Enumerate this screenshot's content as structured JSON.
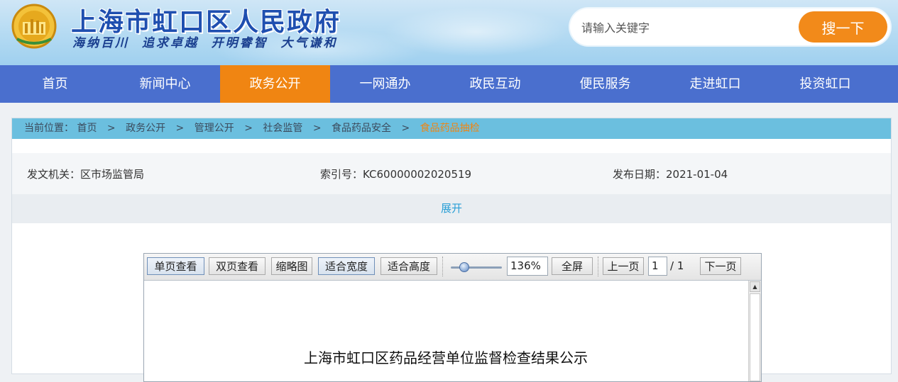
{
  "header": {
    "site_title": "上海市虹口区人民政府",
    "slogan": "海纳百川  追求卓越  开明睿智  大气谦和",
    "search": {
      "placeholder": "请输入关键字",
      "button_label": "搜一下"
    }
  },
  "colors": {
    "nav_bg": "#4a6fce",
    "accent": "#f08512",
    "breadcrumb_bg": "#6bbfdf",
    "link": "#2a9fd6"
  },
  "nav": {
    "items": [
      "首页",
      "新闻中心",
      "政务公开",
      "一网通办",
      "政民互动",
      "便民服务",
      "走进虹口",
      "投资虹口"
    ],
    "active": "政务公开"
  },
  "breadcrumb": {
    "label": "当前位置：",
    "items": [
      "首页",
      "政务公开",
      "管理公开",
      "社会监管",
      "食品药品安全"
    ],
    "current": "食品药品抽检",
    "separator": ">"
  },
  "meta": {
    "issuer": "发文机关：区市场监管局",
    "index_no": "索引号：KC60000002020519",
    "date": "发布日期：2021-01-04"
  },
  "expand_label": "展开",
  "viewer": {
    "buttons": {
      "single": "单页查看",
      "double": "双页查看",
      "thumb": "缩略图",
      "fit_width": "适合宽度",
      "fit_height": "适合高度",
      "fullscreen": "全屏",
      "prev": "上一页",
      "next": "下一页"
    },
    "zoom": "136%",
    "page_current": "1",
    "page_total": "/ 1",
    "doc_title": "上海市虹口区药品经营单位监督检查结果公示"
  }
}
